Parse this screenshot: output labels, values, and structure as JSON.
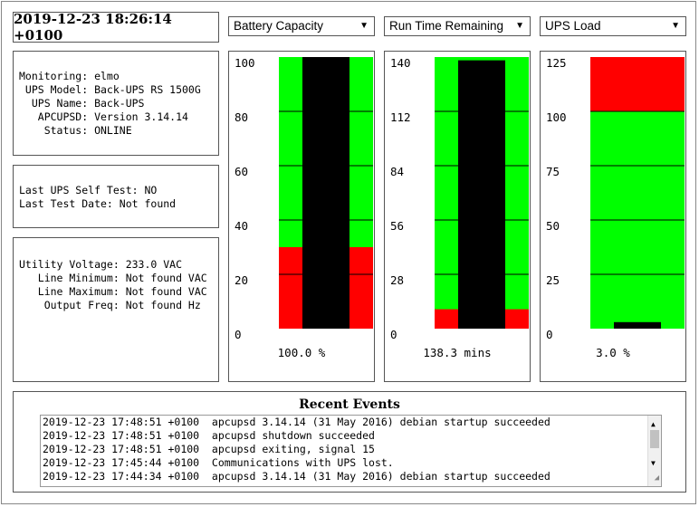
{
  "timestamp": "2019-12-23 18:26:14 +0100",
  "status_box": [
    "Monitoring: elmo",
    " UPS Model: Back-UPS RS 1500G",
    "  UPS Name: Back-UPS",
    "   APCUPSD: Version 3.14.14",
    "    Status: ONLINE"
  ],
  "selftest_box": [
    "Last UPS Self Test: NO",
    "Last Test Date: Not found"
  ],
  "voltage_box": [
    "Utility Voltage: 233.0 VAC",
    "   Line Minimum: Not found VAC",
    "   Line Maximum: Not found VAC",
    "    Output Freq: Not found Hz"
  ],
  "selects": [
    {
      "label": "Battery Capacity",
      "arrow": "▼"
    },
    {
      "label": "Run Time Remaining",
      "arrow": "▼"
    },
    {
      "label": "UPS Load",
      "arrow": "▼"
    }
  ],
  "gauges": [
    {
      "ticks": [
        "100",
        "80",
        "60",
        "40",
        "20",
        "0"
      ],
      "max": 100,
      "value": 100.0,
      "red_to": 30,
      "red_from": null,
      "readout": "100.0 %"
    },
    {
      "ticks": [
        "140",
        "112",
        "84",
        "56",
        "28",
        "0"
      ],
      "max": 140,
      "value": 138.3,
      "red_to": 10,
      "red_from": null,
      "readout": "138.3 mins"
    },
    {
      "ticks": [
        "125",
        "100",
        "75",
        "50",
        "25",
        "0"
      ],
      "max": 125,
      "value": 3.0,
      "red_to": null,
      "red_from": 100,
      "readout": "3.0 %"
    }
  ],
  "colors": {
    "green": "#00ff00",
    "red": "#ff0000",
    "needle": "#000000"
  },
  "events": {
    "title": "Recent Events",
    "lines": [
      "2019-12-23 17:48:51 +0100  apcupsd 3.14.14 (31 May 2016) debian startup succeeded",
      "2019-12-23 17:48:51 +0100  apcupsd shutdown succeeded",
      "2019-12-23 17:48:51 +0100  apcupsd exiting, signal 15",
      "2019-12-23 17:45:44 +0100  Communications with UPS lost.",
      "2019-12-23 17:44:34 +0100  apcupsd 3.14.14 (31 May 2016) debian startup succeeded"
    ]
  }
}
